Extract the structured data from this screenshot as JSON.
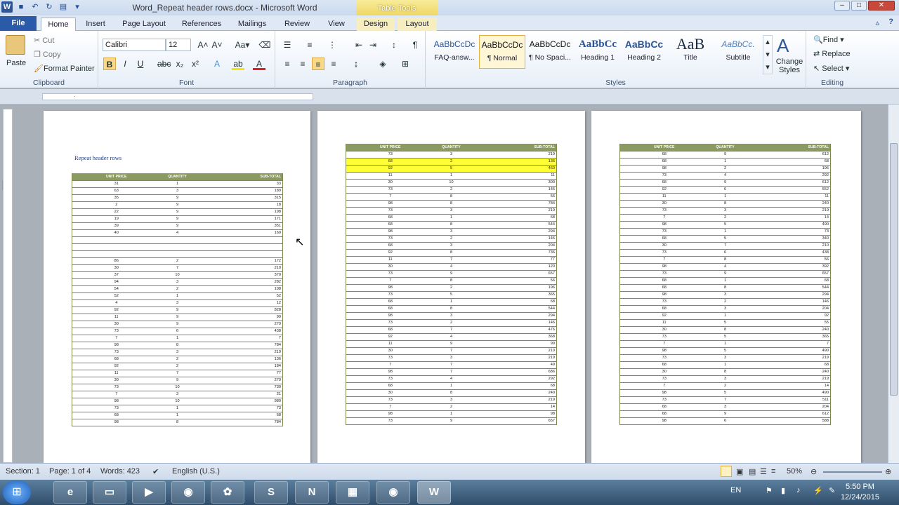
{
  "app": {
    "title": "Word_Repeat header rows.docx - Microsoft Word",
    "context_tab": "Table Tools"
  },
  "tabs": [
    "File",
    "Home",
    "Insert",
    "Page Layout",
    "References",
    "Mailings",
    "Review",
    "View",
    "Design",
    "Layout"
  ],
  "clipboard": {
    "paste": "Paste",
    "cut": "Cut",
    "copy": "Copy",
    "format_painter": "Format Painter",
    "label": "Clipboard"
  },
  "font": {
    "name": "Calibri",
    "size": "12",
    "label": "Font"
  },
  "paragraph": {
    "label": "Paragraph"
  },
  "styles": {
    "items": [
      {
        "preview": "AaBbCcDc",
        "name": "FAQ-answ..."
      },
      {
        "preview": "AaBbCcDc",
        "name": "¶ Normal"
      },
      {
        "preview": "AaBbCcDc",
        "name": "¶ No Spaci..."
      },
      {
        "preview": "AaBbCc",
        "name": "Heading 1"
      },
      {
        "preview": "AaBbCc",
        "name": "Heading 2"
      },
      {
        "preview": "AaB",
        "name": "Title"
      },
      {
        "preview": "AaBbCc.",
        "name": "Subtitle"
      }
    ],
    "change": "Change Styles",
    "label": "Styles"
  },
  "editing": {
    "find": "Find",
    "replace": "Replace",
    "select": "Select",
    "label": "Editing"
  },
  "document": {
    "page1_title": "Repeat header rows",
    "headers": [
      "UNIT PRICE",
      "QUANTITY",
      "SUB-TOTAL"
    ],
    "page1_rows": [
      [
        "31",
        "1",
        "33"
      ],
      [
        "63",
        "3",
        "189"
      ],
      [
        "35",
        "9",
        "315"
      ],
      [
        "2",
        "9",
        "18"
      ],
      [
        "22",
        "9",
        "198"
      ],
      [
        "19",
        "9",
        "171"
      ],
      [
        "39",
        "9",
        "351"
      ],
      [
        "40",
        "4",
        "160"
      ],
      [
        "",
        "",
        ""
      ],
      [
        "",
        "",
        ""
      ],
      [
        "",
        "",
        ""
      ],
      [
        "86",
        "2",
        "172"
      ],
      [
        "30",
        "7",
        "210"
      ],
      [
        "37",
        "10",
        "370"
      ],
      [
        "94",
        "3",
        "282"
      ],
      [
        "54",
        "2",
        "108"
      ],
      [
        "52",
        "1",
        "52"
      ],
      [
        "4",
        "3",
        "12"
      ],
      [
        "92",
        "9",
        "828"
      ],
      [
        "11",
        "9",
        "99"
      ],
      [
        "30",
        "9",
        "270"
      ],
      [
        "73",
        "6",
        "438"
      ],
      [
        "7",
        "1",
        "7"
      ],
      [
        "98",
        "8",
        "784"
      ],
      [
        "73",
        "3",
        "219"
      ],
      [
        "68",
        "2",
        "136"
      ],
      [
        "92",
        "2",
        "184"
      ],
      [
        "11",
        "7",
        "77"
      ],
      [
        "30",
        "9",
        "270"
      ],
      [
        "73",
        "10",
        "730"
      ],
      [
        "7",
        "3",
        "21"
      ],
      [
        "98",
        "10",
        "980"
      ],
      [
        "73",
        "1",
        "73"
      ],
      [
        "68",
        "1",
        "68"
      ],
      [
        "98",
        "8",
        "784"
      ]
    ],
    "page2_rows": [
      [
        "73",
        "3",
        "219"
      ],
      [
        "68",
        "2",
        "136"
      ],
      [
        "92",
        "5",
        "460"
      ],
      [
        "11",
        "1",
        "11"
      ],
      [
        "30",
        "10",
        "300"
      ],
      [
        "73",
        "2",
        "146"
      ],
      [
        "7",
        "8",
        "56"
      ],
      [
        "98",
        "8",
        "784"
      ],
      [
        "73",
        "3",
        "219"
      ],
      [
        "68",
        "1",
        "68"
      ],
      [
        "68",
        "8",
        "544"
      ],
      [
        "98",
        "3",
        "294"
      ],
      [
        "73",
        "2",
        "146"
      ],
      [
        "68",
        "3",
        "204"
      ],
      [
        "92",
        "8",
        "736"
      ],
      [
        "11",
        "7",
        "77"
      ],
      [
        "30",
        "4",
        "120"
      ],
      [
        "73",
        "9",
        "657"
      ],
      [
        "7",
        "8",
        "56"
      ],
      [
        "98",
        "2",
        "196"
      ],
      [
        "73",
        "5",
        "365"
      ],
      [
        "68",
        "1",
        "68"
      ],
      [
        "68",
        "8",
        "544"
      ],
      [
        "98",
        "3",
        "294"
      ],
      [
        "73",
        "2",
        "146"
      ],
      [
        "68",
        "7",
        "476"
      ],
      [
        "92",
        "4",
        "368"
      ],
      [
        "11",
        "9",
        "99"
      ],
      [
        "30",
        "7",
        "210"
      ],
      [
        "73",
        "3",
        "219"
      ],
      [
        "7",
        "7",
        "49"
      ],
      [
        "98",
        "7",
        "686"
      ],
      [
        "73",
        "4",
        "292"
      ],
      [
        "68",
        "1",
        "68"
      ],
      [
        "30",
        "8",
        "240"
      ],
      [
        "73",
        "3",
        "219"
      ],
      [
        "7",
        "2",
        "14"
      ],
      [
        "98",
        "1",
        "98"
      ],
      [
        "73",
        "9",
        "657"
      ]
    ],
    "page2_highlight": [
      1,
      2
    ],
    "page3_rows": [
      [
        "68",
        "9",
        "612"
      ],
      [
        "68",
        "1",
        "68"
      ],
      [
        "98",
        "2",
        "196"
      ],
      [
        "73",
        "4",
        "292"
      ],
      [
        "68",
        "9",
        "612"
      ],
      [
        "92",
        "6",
        "552"
      ],
      [
        "11",
        "1",
        "11"
      ],
      [
        "30",
        "8",
        "240"
      ],
      [
        "73",
        "3",
        "219"
      ],
      [
        "7",
        "2",
        "14"
      ],
      [
        "98",
        "5",
        "490"
      ],
      [
        "73",
        "1",
        "73"
      ],
      [
        "68",
        "5",
        "340"
      ],
      [
        "30",
        "7",
        "210"
      ],
      [
        "73",
        "6",
        "438"
      ],
      [
        "7",
        "8",
        "56"
      ],
      [
        "98",
        "4",
        "392"
      ],
      [
        "73",
        "9",
        "657"
      ],
      [
        "68",
        "1",
        "68"
      ],
      [
        "68",
        "8",
        "544"
      ],
      [
        "98",
        "3",
        "294"
      ],
      [
        "73",
        "2",
        "146"
      ],
      [
        "68",
        "3",
        "204"
      ],
      [
        "92",
        "1",
        "92"
      ],
      [
        "11",
        "5",
        "55"
      ],
      [
        "30",
        "8",
        "240"
      ],
      [
        "73",
        "5",
        "365"
      ],
      [
        "7",
        "1",
        "7"
      ],
      [
        "98",
        "5",
        "490"
      ],
      [
        "73",
        "3",
        "219"
      ],
      [
        "68",
        "1",
        "68"
      ],
      [
        "30",
        "8",
        "240"
      ],
      [
        "73",
        "3",
        "219"
      ],
      [
        "7",
        "2",
        "14"
      ],
      [
        "98",
        "5",
        "490"
      ],
      [
        "73",
        "7",
        "511"
      ],
      [
        "68",
        "3",
        "204"
      ],
      [
        "68",
        "9",
        "612"
      ],
      [
        "98",
        "6",
        "588"
      ]
    ]
  },
  "status": {
    "section": "Section: 1",
    "page": "Page: 1 of 4",
    "words": "Words: 423",
    "language": "English (U.S.)",
    "zoom": "50%"
  },
  "taskbar": {
    "lang": "EN",
    "time": "5:50 PM",
    "date": "12/24/2015"
  }
}
